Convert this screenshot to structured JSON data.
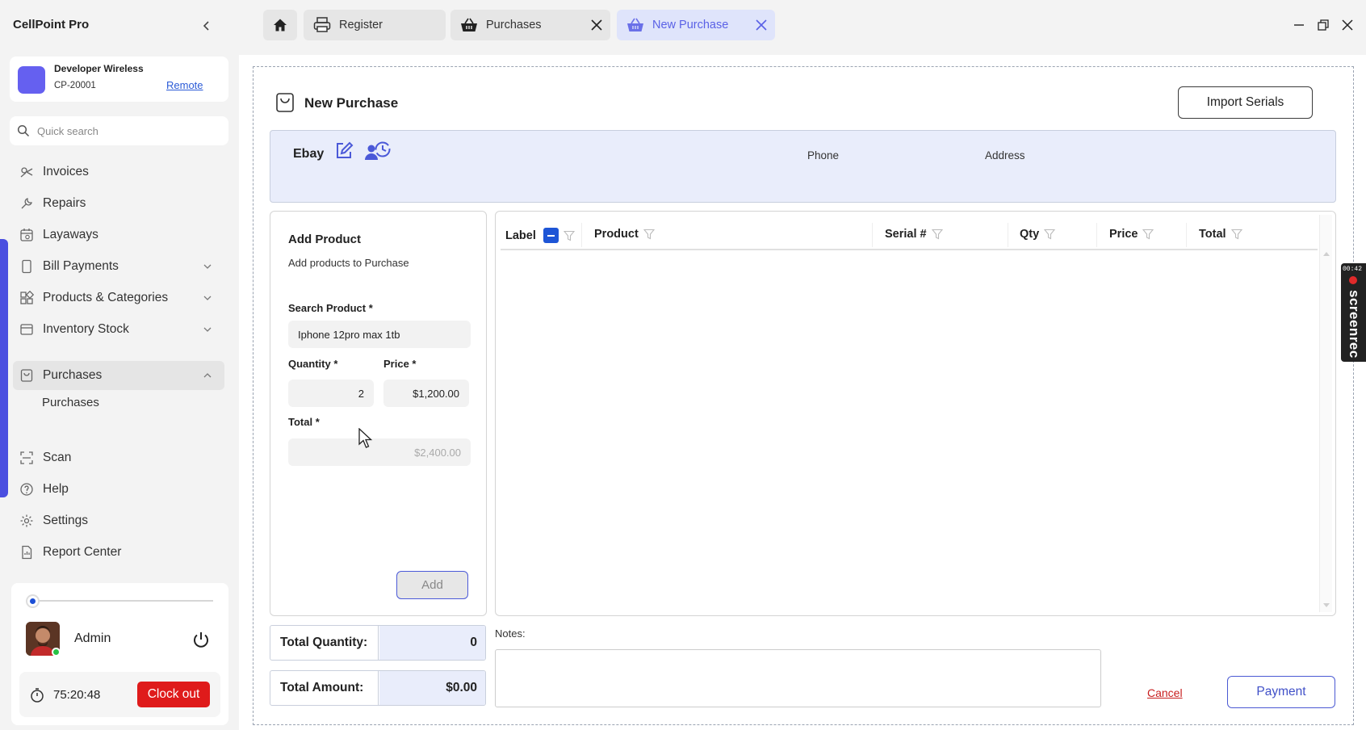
{
  "app": {
    "title": "CellPoint Pro"
  },
  "store": {
    "name": "Developer Wireless",
    "id": "CP-20001",
    "remote_label": "Remote"
  },
  "search": {
    "placeholder": "Quick search"
  },
  "sidebar": {
    "items": [
      {
        "label": "Invoices",
        "icon": "invoices-icon"
      },
      {
        "label": "Repairs",
        "icon": "wrench-icon"
      },
      {
        "label": "Layaways",
        "icon": "layaways-icon"
      },
      {
        "label": "Bill Payments",
        "icon": "bill-icon",
        "expandable": true
      },
      {
        "label": "Products & Categories",
        "icon": "grid-icon",
        "expandable": true
      },
      {
        "label": "Inventory Stock",
        "icon": "box-icon",
        "expandable": true
      },
      {
        "label": "Purchases",
        "icon": "bag-icon",
        "expanded": true,
        "active": true
      },
      {
        "label": "Scan",
        "icon": "scan-icon"
      },
      {
        "label": "Help",
        "icon": "help-icon"
      },
      {
        "label": "Settings",
        "icon": "gear-icon"
      },
      {
        "label": "Report Center",
        "icon": "report-icon"
      }
    ],
    "subitems": {
      "purchases": "Purchases"
    }
  },
  "user": {
    "name": "Admin",
    "timer": "75:20:48",
    "clock_out_label": "Clock out",
    "slider_level": 0.0
  },
  "tabs": [
    {
      "label": "Register",
      "icon": "printer-icon",
      "closable": false
    },
    {
      "label": "Purchases",
      "icon": "basket-icon",
      "closable": true
    },
    {
      "label": "New Purchase",
      "icon": "basket-icon",
      "closable": true,
      "active": true
    }
  ],
  "page": {
    "title": "New Purchase",
    "import_serials_label": "Import Serials"
  },
  "vendor": {
    "name": "Ebay",
    "phone_label": "Phone",
    "address_label": "Address"
  },
  "add_product": {
    "title": "Add Product",
    "subtitle": "Add products to Purchase",
    "search_label": "Search Product *",
    "search_value": "Iphone 12pro max 1tb",
    "quantity_label": "Quantity *",
    "quantity_value": "2",
    "price_label": "Price *",
    "price_value": "$1,200.00",
    "total_label": "Total *",
    "total_value": "$2,400.00",
    "add_label": "Add"
  },
  "table": {
    "columns": [
      "Label",
      "Product",
      "Serial #",
      "Qty",
      "Price",
      "Total"
    ],
    "rows": []
  },
  "totals": {
    "quantity_label": "Total Quantity:",
    "quantity_value": "0",
    "amount_label": "Total Amount:",
    "amount_value": "$0.00"
  },
  "notes": {
    "label": "Notes:"
  },
  "actions": {
    "cancel_label": "Cancel",
    "payment_label": "Payment"
  },
  "recorder": {
    "time": "00:42",
    "label": "screenrec"
  },
  "colors": {
    "accent": "#4b4fe0",
    "danger": "#df1b1b",
    "panel_tint": "#e9edfb",
    "active_tab": "#dfe4fb"
  }
}
